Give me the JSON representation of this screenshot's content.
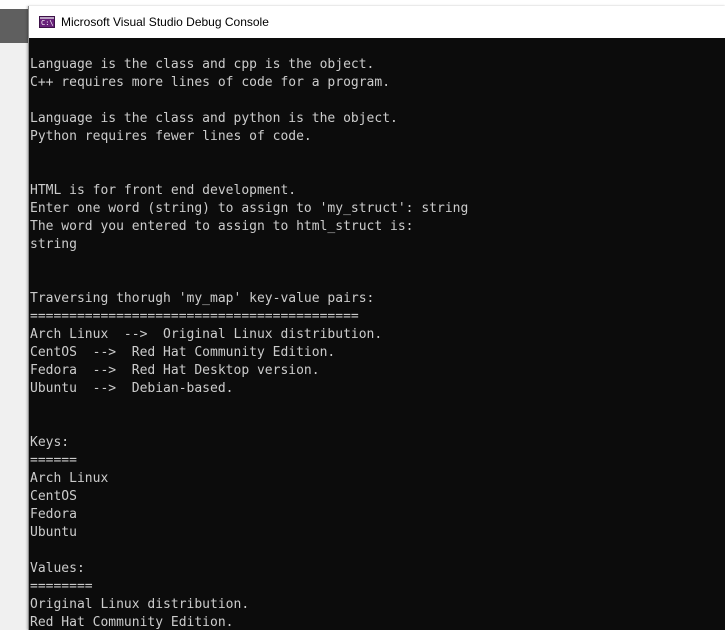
{
  "window": {
    "title": "Microsoft Visual Studio Debug Console",
    "icon": "console-app-icon",
    "icon_glyph": "C:\\",
    "colors": {
      "console_background": "#0c0c0c",
      "console_text": "#cccccc",
      "titlebar": "#ffffff",
      "icon_accent": "#68217a"
    }
  },
  "console": {
    "lines": [
      "Language is the class and cpp is the object.",
      "C++ requires more lines of code for a program.",
      "",
      "Language is the class and python is the object.",
      "Python requires fewer lines of code.",
      "",
      "",
      "HTML is for front end development.",
      "Enter one word (string) to assign to 'my_struct': string",
      "The word you entered to assign to html_struct is:",
      "string",
      "",
      "",
      "Traversing thorugh 'my_map' key-value pairs:",
      "==========================================",
      "Arch Linux  -->  Original Linux distribution.",
      "CentOS  -->  Red Hat Community Edition.",
      "Fedora  -->  Red Hat Desktop version.",
      "Ubuntu  -->  Debian-based.",
      "",
      "",
      "Keys:",
      "======",
      "Arch Linux",
      "CentOS",
      "Fedora",
      "Ubuntu",
      "",
      "Values:",
      "========",
      "Original Linux distribution.",
      "Red Hat Community Edition."
    ]
  }
}
